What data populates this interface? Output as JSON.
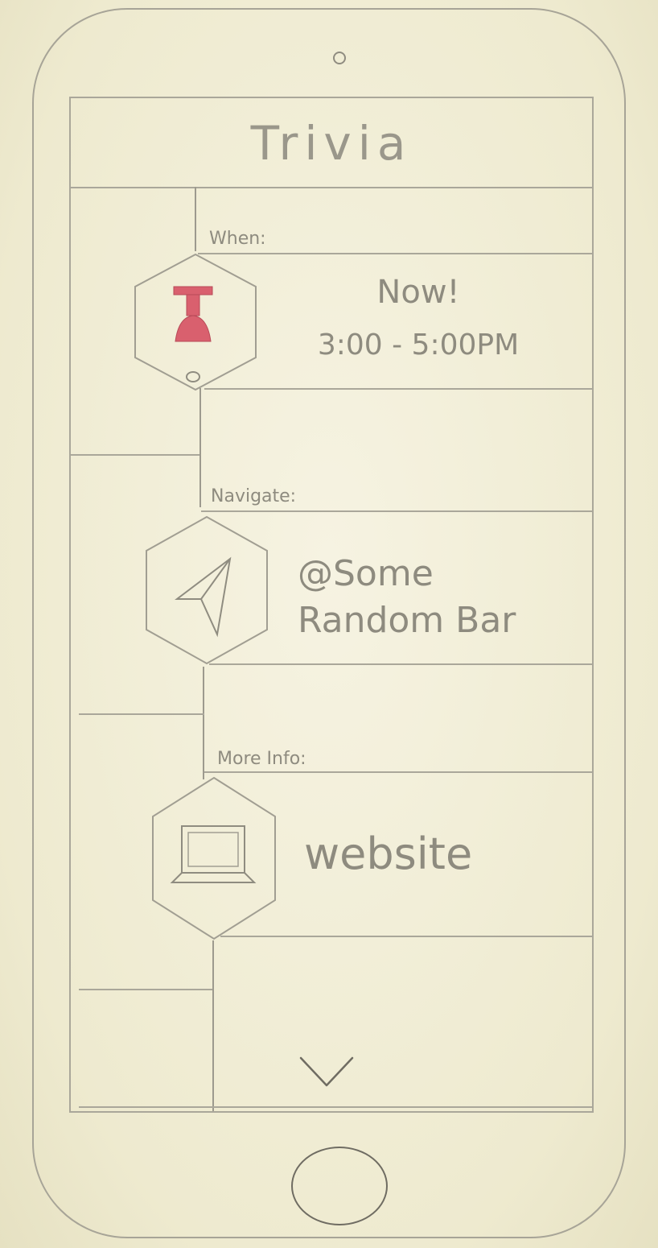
{
  "header": {
    "title": "Trivia"
  },
  "sections": [
    {
      "label": "When:",
      "icon": "pin-icon",
      "line1": "Now!",
      "line2": "3:00 - 5:00PM"
    },
    {
      "label": "Navigate:",
      "icon": "navigation-arrow-icon",
      "line1": "@Some",
      "line2": "Random Bar"
    },
    {
      "label": "More Info:",
      "icon": "laptop-icon",
      "line1": "website"
    }
  ],
  "footer": {
    "expand_icon": "chevron-down-icon"
  },
  "colors": {
    "pencil": "#9a978b",
    "pin_accent": "#d9606e",
    "paper": "#f3f0dc"
  }
}
